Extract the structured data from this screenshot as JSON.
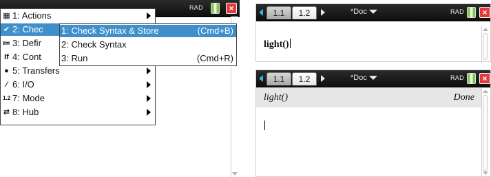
{
  "tabs": [
    "1.1",
    "1.2"
  ],
  "doc_title": "*Doc",
  "mode_label": "RAD",
  "close_glyph": "×",
  "menu": {
    "items": [
      {
        "icon": "program-icon",
        "label": "1: Actions",
        "submenu": true
      },
      {
        "icon": "check-store-icon",
        "label": "2: Chec",
        "submenu": true
      },
      {
        "icon": "define-icon",
        "label": "3: Defir",
        "submenu": true
      },
      {
        "icon": "control-icon",
        "label": "4: Cont",
        "submenu": true
      },
      {
        "icon": "transfers-icon",
        "label": "5: Transfers",
        "submenu": true
      },
      {
        "icon": "io-icon",
        "label": "6: I/O",
        "submenu": true
      },
      {
        "icon": "mode-icon",
        "label": "7: Mode",
        "submenu": true
      },
      {
        "icon": "hub-icon",
        "label": "8: Hub",
        "submenu": true
      }
    ],
    "icon_glyphs": [
      "▦",
      "✔",
      "≔",
      "If",
      "●",
      "⁄",
      "1.2",
      "⇄"
    ]
  },
  "submenu": {
    "items": [
      {
        "label": "1: Check Syntax & Store",
        "shortcut": "(Cmd+B)"
      },
      {
        "label": "2: Check Syntax",
        "shortcut": ""
      },
      {
        "label": "3: Run",
        "shortcut": "(Cmd+R)"
      }
    ]
  },
  "editor_top": {
    "text": "light()"
  },
  "editor_bottom": {
    "expr": "light()",
    "result": "Done"
  },
  "colors": {
    "accent": "#3f8fcb",
    "close": "#e23a3a",
    "battery": "#7ac943",
    "active_row": "#e6e6e6"
  }
}
